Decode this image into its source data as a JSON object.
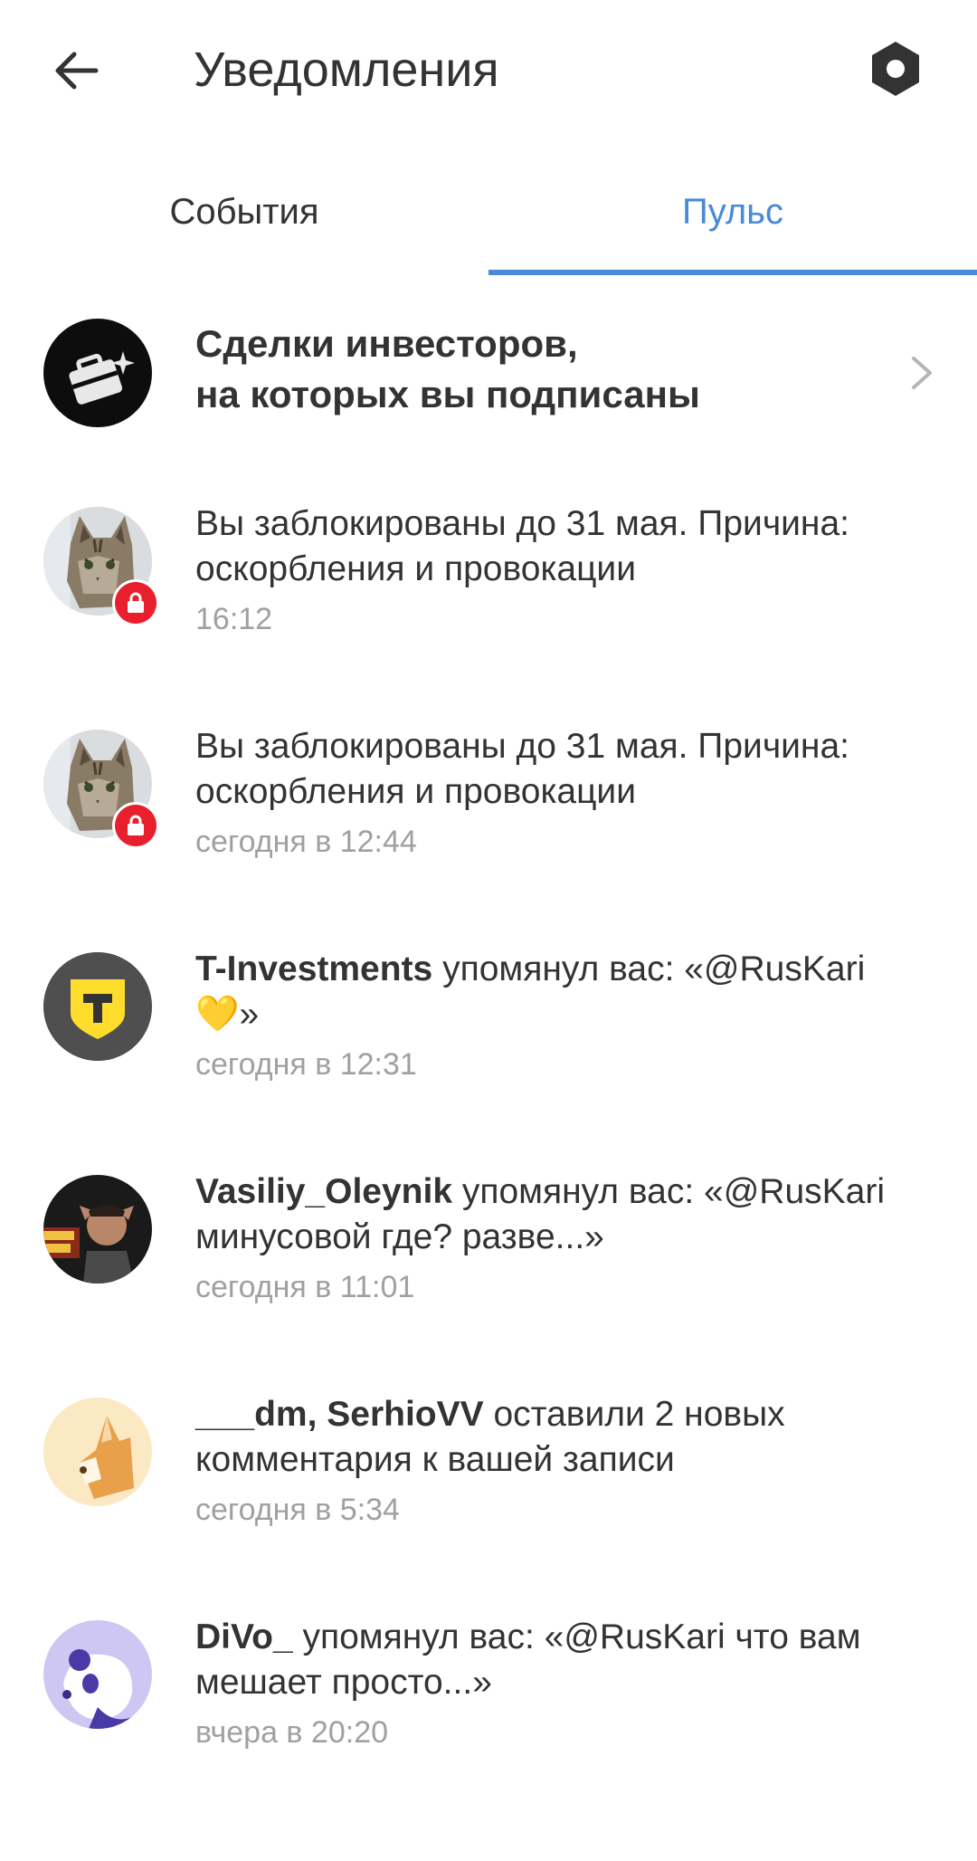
{
  "header": {
    "title": "Уведомления",
    "back_icon": "arrow-left-icon",
    "settings_icon": "hexagon-settings-icon"
  },
  "tabs": [
    {
      "label": "События",
      "active": false
    },
    {
      "label": "Пульс",
      "active": true
    }
  ],
  "colors": {
    "accent": "#4a8ad6",
    "text": "#333333",
    "secondary": "#a0a0a0",
    "lock_badge": "#e8202e",
    "tinkoff_yellow": "#ffdd2d"
  },
  "trades_banner": {
    "line1": "Сделки инвесторов,",
    "line2": "на которых вы подписаны",
    "icon": "briefcase-sparkle-icon"
  },
  "notifications": [
    {
      "avatar": "cat-avatar",
      "badge": "lock-icon",
      "author": "",
      "text": "Вы заблокированы до 31 мая. Причина: оскорбления и провокации",
      "time": "16:12"
    },
    {
      "avatar": "cat-avatar",
      "badge": "lock-icon",
      "author": "",
      "text": "Вы заблокированы до 31 мая. Причина: оскорбления и провокации",
      "time": "сегодня в 12:44"
    },
    {
      "avatar": "t-investments-logo",
      "author": "T-Investments",
      "text": " упомянул вас: «@RusKari 💛»",
      "time": "сегодня в 12:31"
    },
    {
      "avatar": "person-photo-avatar",
      "author": "Vasiliy_Oleynik",
      "text": " упомянул вас: «@RusKari минусовой где? разве...»",
      "time": "сегодня в 11:01"
    },
    {
      "avatar": "dog-avatar",
      "author": "___dm, SerhioVV",
      "text": " оставили 2 новых комментария к вашей записи",
      "time": "сегодня в 5:34"
    },
    {
      "avatar": "panda-avatar",
      "author": "DiVo_",
      "text": " упомянул вас: «@RusKari что вам мешает просто...»",
      "time": "вчера в 20:20"
    }
  ]
}
